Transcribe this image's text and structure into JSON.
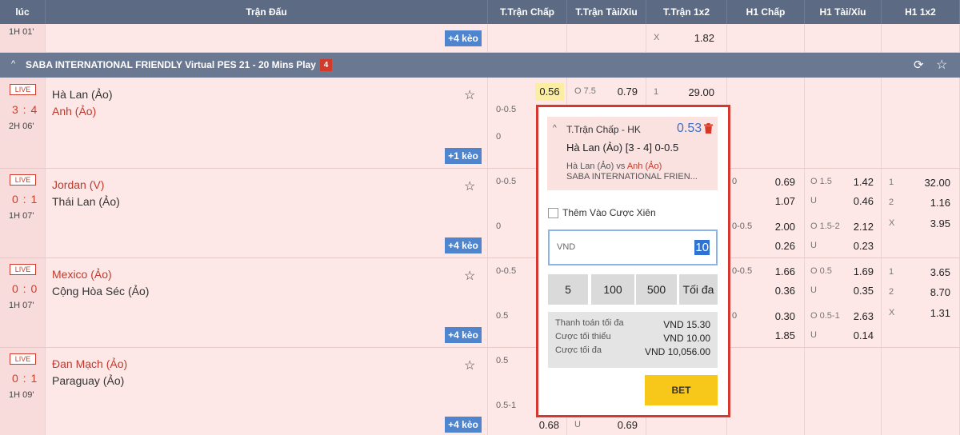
{
  "header": {
    "cols": [
      "lúc",
      "Trận Đấu",
      "T.Trận Chấp",
      "T.Trận Tài/Xỉu",
      "T.Trận 1x2",
      "H1 Chấp",
      "H1 Tài/Xỉu",
      "H1 1x2"
    ]
  },
  "top_row": {
    "time": "1H 01'",
    "more": "+4 kèo",
    "x_label": "X",
    "x_odd": "1.82"
  },
  "league": {
    "name": "SABA INTERNATIONAL FRIENDLY Virtual PES 21 - 20 Mins Play",
    "count": "4",
    "chevron": "^"
  },
  "matches": [
    {
      "live": "LIVE",
      "score": "3 : 4",
      "time": "2H 06'",
      "home": "Hà Lan (Ảo)",
      "away": "Anh (Ảo)",
      "more": "+1 kèo",
      "hdp1": "0-0.5",
      "hdp2": "0",
      "odd_hl": "0.56",
      "ou_label": "O 7.5",
      "ou_odd": "0.79",
      "x12_label": "1",
      "x12_odd": "29.00"
    },
    {
      "live": "LIVE",
      "score": "0 : 1",
      "time": "1H 07'",
      "home": "Jordan (V)",
      "away": "Thái Lan (Ảo)",
      "more": "+4 kèo",
      "hdp1": "0-0.5",
      "hdp2": "0",
      "h1_hdp1": "0",
      "h1_odd1": "0.69",
      "h1_odd2": "1.07",
      "h1_hdp2": "0-0.5",
      "h1_odd3": "2.00",
      "h1_odd4": "0.26",
      "h1_ou1": "O 1.5",
      "h1_ou1_odd": "1.42",
      "h1_u1": "U",
      "h1_u1_odd": "0.46",
      "h1_ou2": "O 1.5-2",
      "h1_ou2_odd": "2.12",
      "h1_u2": "U",
      "h1_u2_odd": "0.23",
      "h1x2": [
        [
          "1",
          "32.00"
        ],
        [
          "2",
          "1.16"
        ],
        [
          "X",
          "3.95"
        ]
      ]
    },
    {
      "live": "LIVE",
      "score": "0 : 0",
      "time": "1H 07'",
      "home": "Mexico (Ảo)",
      "away": "Cộng Hòa Séc (Ảo)",
      "more": "+4 kèo",
      "hdp1": "0-0.5",
      "hdp2": "0.5",
      "h1_hdp1": "0-0.5",
      "h1_odd1": "1.66",
      "h1_odd2": "0.36",
      "h1_hdp2": "0",
      "h1_odd3": "0.30",
      "h1_odd4": "1.85",
      "h1_ou1": "O 0.5",
      "h1_ou1_odd": "1.69",
      "h1_u1": "U",
      "h1_u1_odd": "0.35",
      "h1_ou2": "O 0.5-1",
      "h1_ou2_odd": "2.63",
      "h1_u2": "U",
      "h1_u2_odd": "0.14",
      "h1x2": [
        [
          "1",
          "3.65"
        ],
        [
          "2",
          "8.70"
        ],
        [
          "X",
          "1.31"
        ]
      ]
    },
    {
      "live": "LIVE",
      "score": "0 : 1",
      "time": "1H 09'",
      "home": "Đan Mạch (Ảo)",
      "away": "Paraguay (Ảo)",
      "more": "+4 kèo",
      "hdp1": "0.5",
      "hdp2": "0.5-1",
      "bottom_odd": "0.68",
      "bottom_u": "U",
      "bottom_u_odd": "0.69"
    }
  ],
  "betslip": {
    "market": "T.Trận Chấp - HK",
    "price": "0.53",
    "pick": "Hà Lan (Ảo) [3 - 4]  0-0.5",
    "vs_home": "Hà Lan (Ảo) vs ",
    "vs_away": "Anh (Ảo)",
    "league": "SABA INTERNATIONAL FRIEN...",
    "parlay_label": "Thêm Vào Cược Xiên",
    "currency": "VND",
    "amount": "10",
    "quick": [
      "5",
      "100",
      "500",
      "Tối đa"
    ],
    "info": [
      {
        "k": "Thanh toán tối đa",
        "v": "VND 15.30"
      },
      {
        "k": "Cược tối thiểu",
        "v": "VND 10.00"
      },
      {
        "k": "Cược tối đa",
        "v": "VND 10,056.00"
      }
    ],
    "bet_label": "BET"
  },
  "colors": {
    "header_bg": "#5c6a83",
    "row_bg": "#fde8e7",
    "live_red": "#d23a2a",
    "more_blue": "#4f84cf",
    "bet_yellow": "#f7c719",
    "slip_border": "#d6382f"
  }
}
